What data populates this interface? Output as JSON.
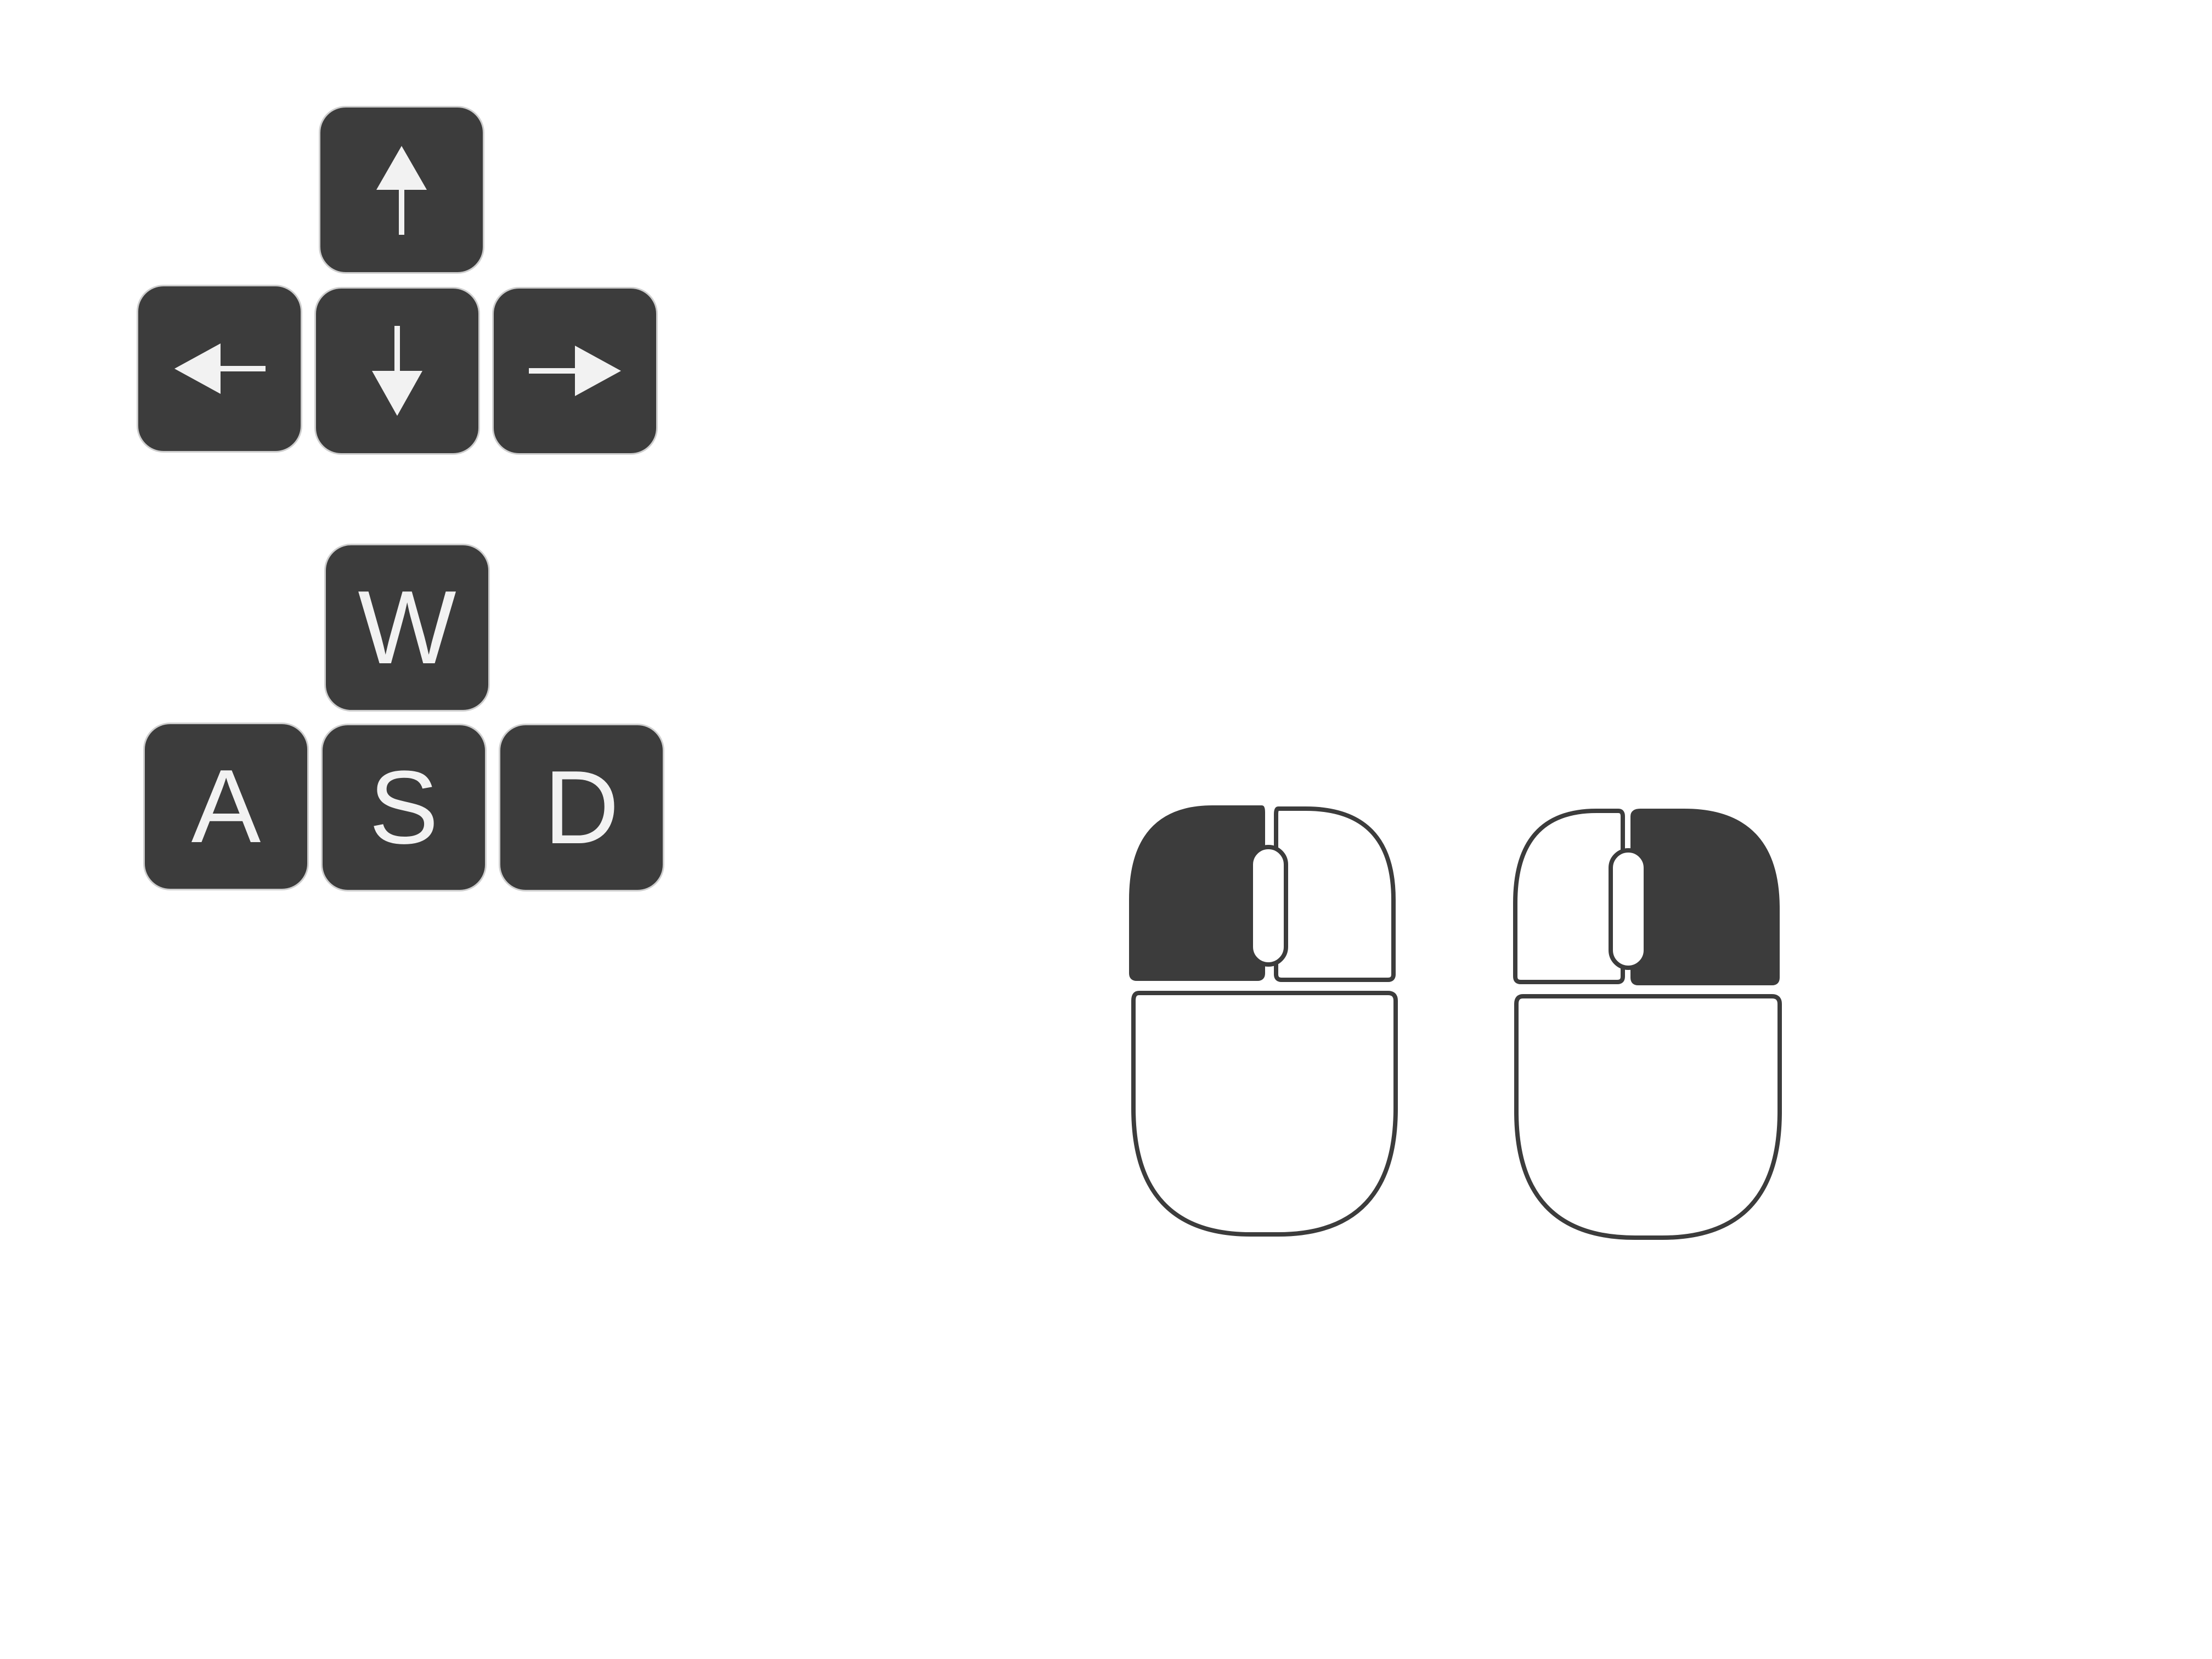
{
  "colors": {
    "key_fill": "#3c3c3c",
    "key_glyph": "#f2f2f2",
    "mouse_outline": "#3c3c3c",
    "mouse_highlight": "#3c3c3c",
    "background": "#ffffff"
  },
  "arrow_keys": {
    "up": {
      "icon": "arrow-up-icon"
    },
    "left": {
      "icon": "arrow-left-icon"
    },
    "down": {
      "icon": "arrow-down-icon"
    },
    "right": {
      "icon": "arrow-right-icon"
    }
  },
  "wasd_keys": {
    "w": "W",
    "a": "A",
    "s": "S",
    "d": "D"
  },
  "mice": {
    "left_click": {
      "icon": "mouse-left-click-icon",
      "highlighted_button": "left"
    },
    "right_click": {
      "icon": "mouse-right-click-icon",
      "highlighted_button": "right"
    }
  }
}
